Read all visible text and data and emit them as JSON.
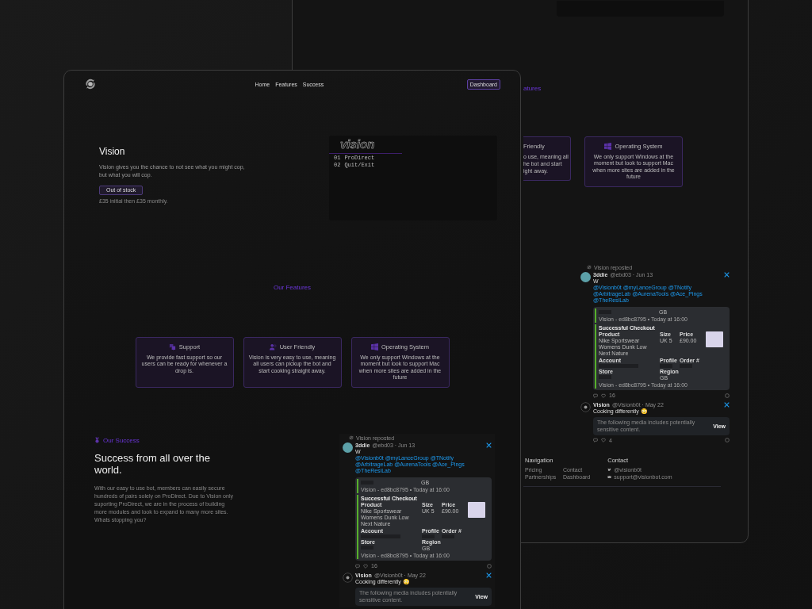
{
  "back_window": {
    "heading_fragment": "atures",
    "feature_cards": [
      {
        "kind": "partial",
        "title": "Friendly",
        "lines": [
          "o use, meaning all",
          "he bot and start",
          "ight away."
        ]
      },
      {
        "kind": "windows",
        "title": "Operating System",
        "text": "We only support Windows at the moment but look to support Mac when more sites are added in the future"
      }
    ],
    "feed": {
      "reposted_label": "Vision reposted",
      "posts": [
        {
          "kind": "checkout",
          "author": "3ddie",
          "meta": "@ebd03 · Jun 13",
          "text": "W",
          "mentions": "@Visionb0t @myLanceGroup @TNotify @ArbitrageLab @AurenaTools @Ace_Pings @TheResiLab",
          "checkout": {
            "prev_value": "GB",
            "prev_footer": "Vision - ed8bc8795 • Today at 16:00",
            "title": "Successful Checkout",
            "product_label": "Product",
            "product": "Nike Sportswear Womens Dunk Low Next Nature",
            "size_label": "Size",
            "size": "UK 5",
            "price_label": "Price",
            "price": "£90.00",
            "account_label": "Account",
            "profile_label": "Profile",
            "order_label": "Order #",
            "store_label": "Store",
            "region_label": "Region",
            "region": "GB",
            "footer": "Vision - ed8bc8795 • Today at 16:00"
          },
          "likes": "16"
        },
        {
          "kind": "sensitive",
          "author": "Vision",
          "meta": "@Visionb0t · May 22",
          "text": "Cooking differently 😳",
          "notice": "The following media includes potentially sensitive content.",
          "view_label": "View",
          "likes": "4"
        }
      ]
    },
    "footer": {
      "nav_title": "Navigation",
      "nav_links": [
        "Pricing",
        "Contact",
        "Partnerships",
        "Dashboard"
      ],
      "contact_title": "Contact",
      "contacts": [
        {
          "kind": "twitter",
          "text": "@visionb0t"
        },
        {
          "kind": "mail",
          "text": "support@visionbot.com"
        }
      ]
    }
  },
  "front_window": {
    "nav": {
      "links": [
        "Home",
        "Features",
        "Success"
      ],
      "dashboard": "Dashboard"
    },
    "hero": {
      "title": "Vision",
      "description": "Vision gives you the chance to not see what you might cop, but what you will cop.",
      "button": "Out of stock",
      "price_note": "£35 initial then £35 monthly.",
      "terminal": {
        "logo": "vision",
        "menu": [
          {
            "num": "01",
            "label": "ProDirect"
          },
          {
            "num": "02",
            "label": "Quit/Exit"
          }
        ]
      }
    },
    "features": {
      "heading": "Our Features",
      "cards": [
        {
          "kind": "support",
          "title": "Support",
          "text": "We provide fast support so our users can be ready for whenever a drop is."
        },
        {
          "kind": "users",
          "title": "User Friendly",
          "text": "Vision is very easy to use, meaning all users can pickup the bot and start cooking straight away."
        },
        {
          "kind": "windows",
          "title": "Operating System",
          "text": "We only support Windows at the moment but look to support Mac when more sites are added in the future"
        }
      ]
    },
    "success": {
      "label": "Our Success",
      "heading": "Success from all over the world.",
      "text": "With our easy to use bot, members can easily secure hundreds of pairs solely on ProDirect. Due to Vision only suporting ProDirect, we are in the process of building more modules and look to expand to many more sites. Whats stopping you?"
    },
    "feed": {
      "reposted_label": "Vision reposted",
      "posts": [
        {
          "kind": "checkout",
          "author": "3ddie",
          "meta": "@ebd03 · Jun 13",
          "text": "W",
          "mentions": "@Visionb0t @myLanceGroup @TNotify @ArbitrageLab @AurenaTools @Ace_Pings @TheResiLab",
          "checkout": {
            "prev_value": "GB",
            "prev_footer": "Vision - ed8bc8795 • Today at 16:00",
            "title": "Successful Checkout",
            "product_label": "Product",
            "product": "Nike Sportswear Womens Dunk Low Next Nature",
            "size_label": "Size",
            "size": "UK 5",
            "price_label": "Price",
            "price": "£90.00",
            "account_label": "Account",
            "profile_label": "Profile",
            "order_label": "Order #",
            "store_label": "Store",
            "region_label": "Region",
            "region": "GB",
            "footer": "Vision - ed8bc8795 • Today at 16:00"
          },
          "likes": "16"
        },
        {
          "kind": "sensitive",
          "author": "Vision",
          "meta": "@Visionb0t · May 22",
          "text": "Cooking differently 😳",
          "notice": "The following media includes potentially sensitive content.",
          "view_label": "View"
        }
      ]
    }
  }
}
